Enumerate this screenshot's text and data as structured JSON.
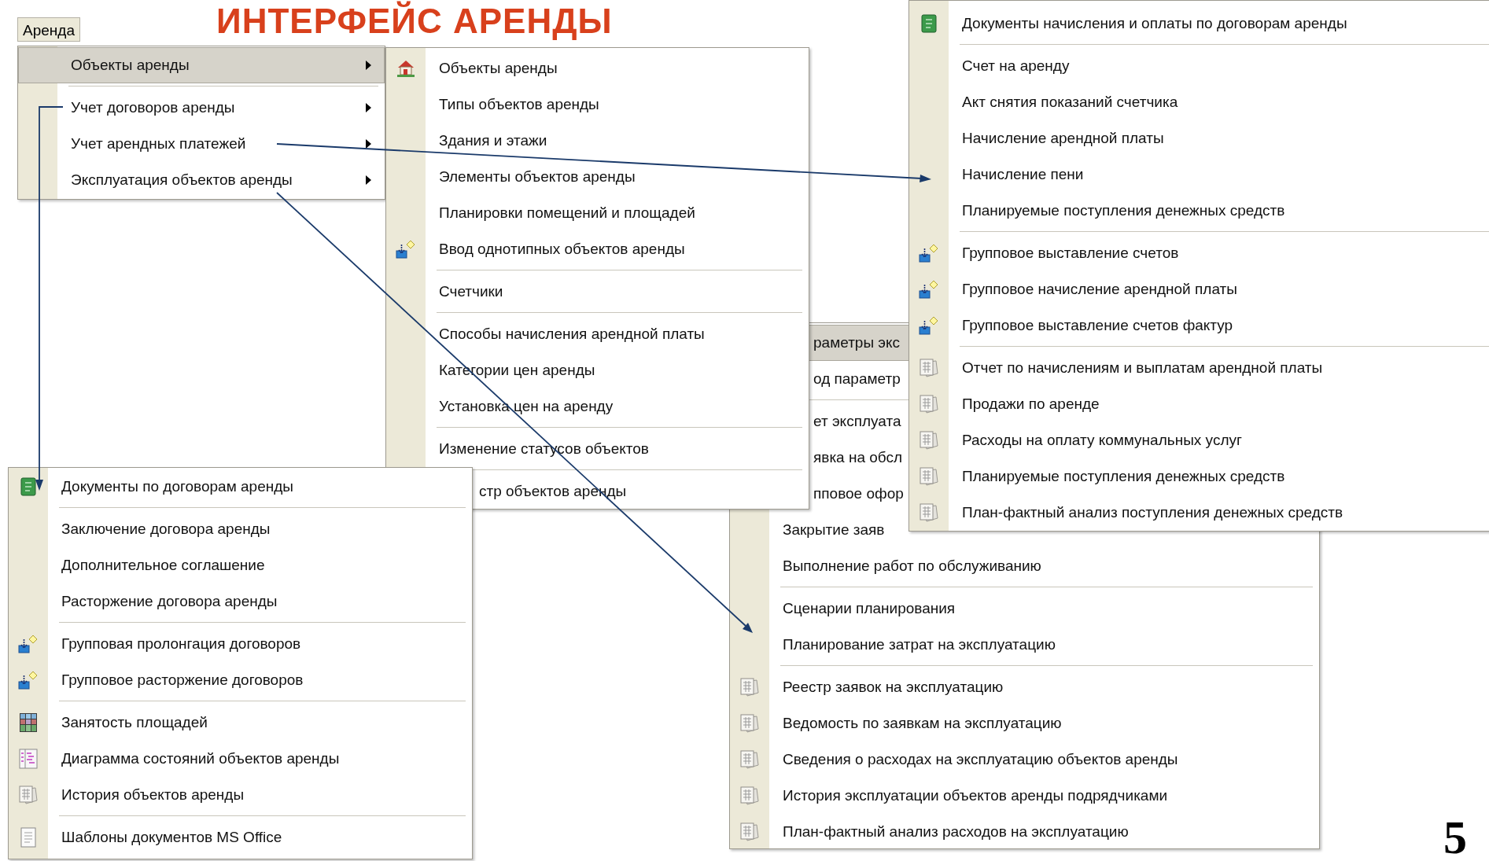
{
  "title": {
    "text": "ИНТЕРФЕЙС АРЕНДЫ"
  },
  "menu_bar": {
    "label": "Аренда"
  },
  "main_menu": {
    "groups": [
      [
        {
          "label": "Объекты аренды",
          "selected": true,
          "has_submenu": true
        }
      ],
      [
        {
          "label": "Учет договоров аренды",
          "selected": false,
          "has_submenu": true
        },
        {
          "label": "Учет арендных платежей",
          "selected": false,
          "has_submenu": true
        },
        {
          "label": "Эксплуатация объектов аренды",
          "selected": false,
          "has_submenu": true
        }
      ]
    ]
  },
  "exploitation_submenu": {
    "groups": [
      [
        {
          "label": "раметры экс",
          "kind": "partial",
          "selected": true
        },
        {
          "label": "од параметр",
          "kind": "partial",
          "selected": false
        }
      ],
      [
        {
          "label": "ет эксплуата",
          "kind": "partial",
          "selected": false
        },
        {
          "label": "явка на обсл",
          "kind": "partial",
          "selected": false
        },
        {
          "label": "пповое офор",
          "kind": "partial",
          "selected": false
        },
        {
          "label": "Закрытие заяв",
          "kind": "plain",
          "selected": false
        },
        {
          "label": "Выполнение работ по обслуживанию",
          "kind": "plain",
          "selected": false
        }
      ],
      [
        {
          "label": "Сценарии планирования",
          "kind": "plain",
          "selected": false
        },
        {
          "label": "Планирование затрат на эксплуатацию",
          "kind": "plain",
          "selected": false
        }
      ],
      [
        {
          "label": "Реестр заявок на эксплуатацию",
          "kind": "report",
          "selected": false
        },
        {
          "label": "Ведомость по заявкам на эксплуатацию",
          "kind": "report",
          "selected": false
        },
        {
          "label": "Сведения о расходах на эксплуатацию объектов аренды",
          "kind": "report",
          "selected": false
        },
        {
          "label": "История эксплуатации объектов аренды подрядчиками",
          "kind": "report",
          "selected": false
        },
        {
          "label": "План-фактный анализ расходов на эксплуатацию",
          "kind": "report",
          "selected": false
        }
      ]
    ]
  },
  "objects_submenu": {
    "groups": [
      [
        {
          "label": "Объекты аренды",
          "kind": "house"
        },
        {
          "label": "Типы объектов аренды",
          "kind": "plain"
        },
        {
          "label": "Здания и этажи",
          "kind": "plain"
        },
        {
          "label": "Элементы объектов аренды",
          "kind": "plain"
        },
        {
          "label": "Планировки помещений и площадей",
          "kind": "plain"
        },
        {
          "label": "Ввод однотипных объектов аренды",
          "kind": "batch"
        }
      ],
      [
        {
          "label": "Счетчики",
          "kind": "plain"
        }
      ],
      [
        {
          "label": "Способы начисления арендной платы",
          "kind": "plain"
        },
        {
          "label": "Категории цен аренды",
          "kind": "plain"
        },
        {
          "label": "Установка цен на аренду",
          "kind": "plain"
        }
      ],
      [
        {
          "label": "Изменение статусов объектов",
          "kind": "plain"
        }
      ],
      [
        {
          "label": "стр объектов аренды",
          "kind": "partial"
        }
      ]
    ]
  },
  "payments_submenu": {
    "groups": [
      [
        {
          "label": "Документы начисления и оплаты по договорам аренды",
          "kind": "ledger"
        }
      ],
      [
        {
          "label": "Счет на аренду",
          "kind": "plain"
        },
        {
          "label": "Акт снятия показаний счетчика",
          "kind": "plain"
        },
        {
          "label": "Начисление арендной платы",
          "kind": "plain"
        },
        {
          "label": "Начисление пени",
          "kind": "plain"
        },
        {
          "label": "Планируемые поступления денежных средств",
          "kind": "plain"
        }
      ],
      [
        {
          "label": "Групповое выставление счетов",
          "kind": "batch"
        },
        {
          "label": "Групповое начисление арендной платы",
          "kind": "batch"
        },
        {
          "label": "Групповое выставление счетов фактур",
          "kind": "batch"
        }
      ],
      [
        {
          "label": "Отчет по начислениям и выплатам арендной платы",
          "kind": "report"
        },
        {
          "label": "Продажи по аренде",
          "kind": "report"
        },
        {
          "label": "Расходы на оплату коммунальных услуг",
          "kind": "report"
        },
        {
          "label": "Планируемые поступления денежных средств",
          "kind": "report"
        },
        {
          "label": "План-фактный анализ поступления денежных средств",
          "kind": "report"
        }
      ]
    ]
  },
  "contracts_submenu": {
    "groups": [
      [
        {
          "label": "Документы по договорам аренды",
          "kind": "ledger"
        }
      ],
      [
        {
          "label": "Заключение договора аренды",
          "kind": "plain"
        },
        {
          "label": "Дополнительное соглашение",
          "kind": "plain"
        },
        {
          "label": "Расторжение договора аренды",
          "kind": "plain"
        }
      ],
      [
        {
          "label": "Групповая пролонгация договоров",
          "kind": "batch"
        },
        {
          "label": "Групповое расторжение договоров",
          "kind": "batch"
        }
      ],
      [
        {
          "label": "Занятость площадей",
          "kind": "grid"
        },
        {
          "label": "Диаграмма состояний объектов аренды",
          "kind": "diagram"
        },
        {
          "label": "История объектов аренды",
          "kind": "report"
        }
      ],
      [
        {
          "label": "Шаблоны документов MS Office",
          "kind": "document"
        }
      ]
    ]
  },
  "slide_number": "5"
}
